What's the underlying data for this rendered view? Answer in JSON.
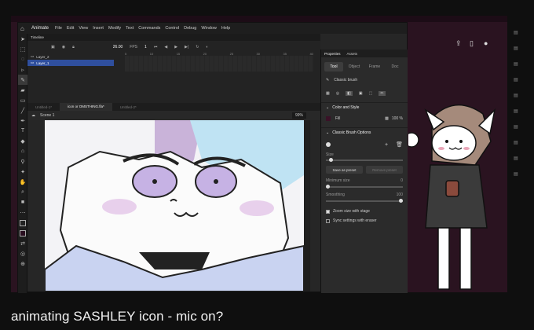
{
  "app": {
    "name": "Animate",
    "menu": [
      "File",
      "Edit",
      "View",
      "Insert",
      "Modify",
      "Text",
      "Commands",
      "Control",
      "Debug",
      "Window",
      "Help"
    ]
  },
  "timeline": {
    "title": "Timeline",
    "fps": "26.00",
    "fps_unit": "FPS",
    "frame_number": "1",
    "ticks": [
      "5",
      "10",
      "15",
      "20",
      "25",
      "30",
      "35",
      "40"
    ],
    "layers": [
      {
        "name": "Layer_2"
      },
      {
        "name": "Layer_1"
      }
    ]
  },
  "documents": {
    "tabs": [
      "Untitled-1*",
      "icon or OMSTHING.fla*",
      "Untitled-2*"
    ]
  },
  "scene": {
    "name": "Scene 1",
    "zoom": "99%"
  },
  "properties": {
    "header_tabs": [
      "Properties",
      "Assets"
    ],
    "tabs": [
      "Tool",
      "Object",
      "Frame",
      "Doc"
    ],
    "brush_name": "Classic brush",
    "color_section": "Color and Style",
    "fill_label": "Fill",
    "fill_opacity": "100 %",
    "brush_section": "Classic Brush Options",
    "size_label": "Size",
    "save_preset": "Save as preset",
    "remove_preset": "Remove preset",
    "min_size_label": "Minimum size",
    "min_size_value": "0",
    "smoothing_label": "Smoothing",
    "smoothing_value": "100",
    "zoom_with_stage": "Zoom size with stage",
    "sync_with_eraser": "Sync settings with eraser"
  },
  "caption": "animating SASHLEY icon - mic on?"
}
